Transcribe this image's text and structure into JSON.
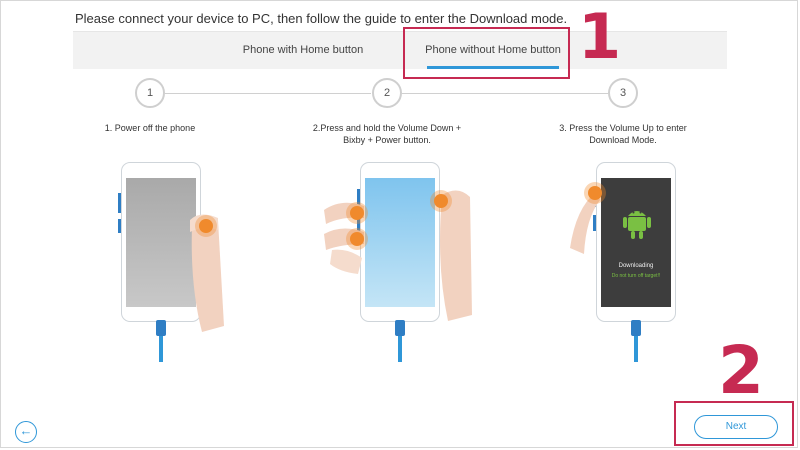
{
  "instruction": "Please connect your device to PC, then follow the guide to enter the Download mode.",
  "tabs": [
    {
      "label": "Phone with Home button",
      "active": false
    },
    {
      "label": "Phone without Home button",
      "active": true
    }
  ],
  "steps": [
    {
      "number": "1",
      "text": "1. Power off the phone"
    },
    {
      "number": "2",
      "text": "2.Press and hold the Volume Down +\nBixby + Power button."
    },
    {
      "number": "3",
      "text": "3. Press the Volume Up to enter\nDownload Mode."
    }
  ],
  "download_screen": {
    "title": "Downloading",
    "warning": "Do not turn off target!!"
  },
  "annotations": [
    "1",
    "2"
  ],
  "buttons": {
    "back_icon": "←",
    "next": "Next"
  },
  "colors": {
    "accent": "#2f97d8",
    "annotation": "#c62a52",
    "press_indicator": "#f08a2c",
    "android": "#7ac043"
  },
  "icons": [
    "back-arrow-icon",
    "android-robot-icon",
    "finger-hand-icon"
  ]
}
